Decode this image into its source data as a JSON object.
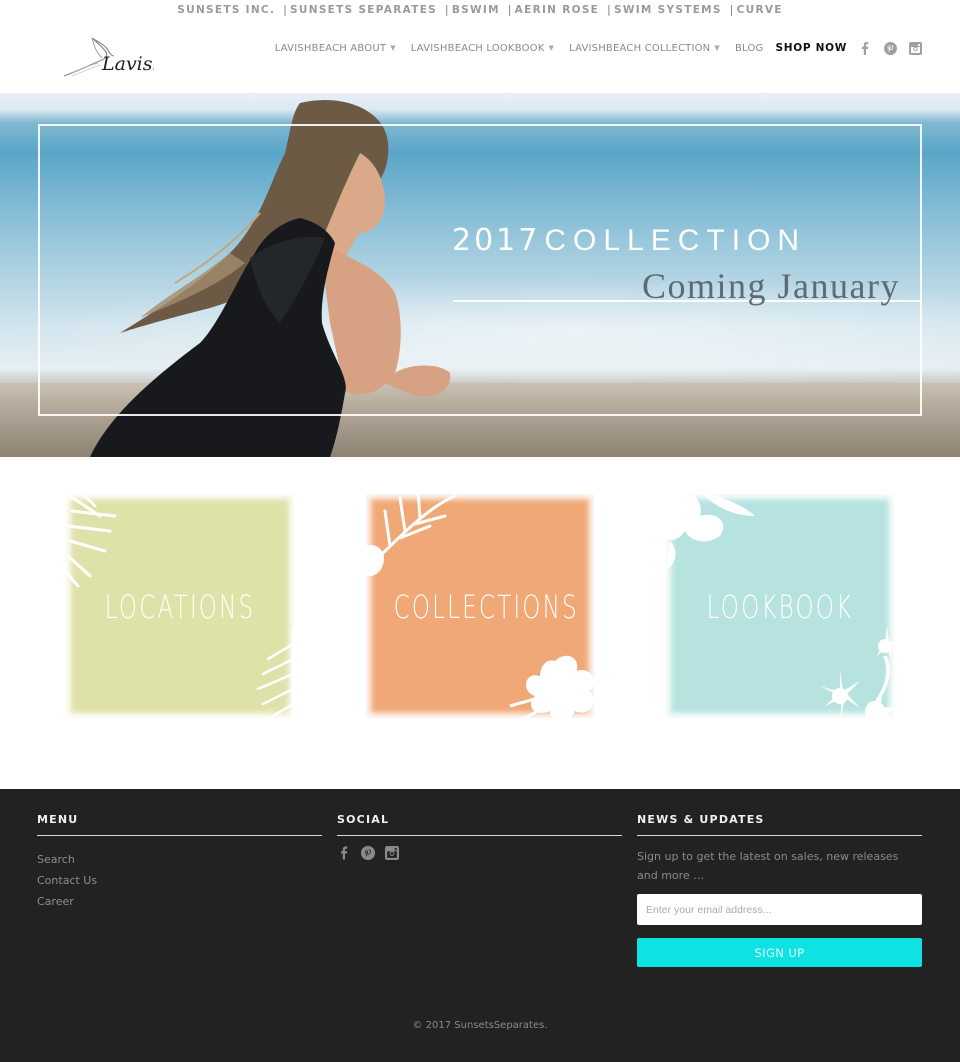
{
  "brand_bar": {
    "items": [
      "SUNSETS INC.",
      "SUNSETS SEPARATES",
      "BSWIM",
      "AERIN ROSE",
      "SWIM SYSTEMS",
      "CURVE"
    ],
    "separator": "|"
  },
  "header": {
    "logo_text": "Lavish",
    "nav": [
      {
        "label": "LAVISHBEACH ABOUT",
        "caret": "▼"
      },
      {
        "label": "LAVISHBEACH LOOKBOOK",
        "caret": "▼"
      },
      {
        "label": "LAVISHBEACH COLLECTION",
        "caret": "▼"
      },
      {
        "label": "BLOG"
      },
      {
        "label": "SHOP NOW"
      }
    ],
    "social_icons": [
      "facebook-icon",
      "pinterest-icon",
      "instagram-icon"
    ]
  },
  "hero": {
    "year": "2017",
    "title": "COLLECTION",
    "subtitle": "Coming January"
  },
  "tiles": [
    {
      "label": "LOCATIONS",
      "color": "#dfe2a8"
    },
    {
      "label": "COLLECTIONS",
      "color": "#f0a877"
    },
    {
      "label": "LOOKBOOK",
      "color": "#b6e3df"
    }
  ],
  "footer": {
    "menu": {
      "heading": "MENU",
      "links": [
        "Search",
        "Contact Us",
        "Career"
      ]
    },
    "social": {
      "heading": "SOCIAL",
      "icons": [
        "facebook-icon",
        "pinterest-icon",
        "instagram-icon"
      ]
    },
    "news": {
      "heading": "NEWS & UPDATES",
      "text": "Sign up to get the latest on sales, new releases and more …",
      "email_placeholder": "Enter your email address...",
      "email_value": "",
      "button_label": "SIGN UP",
      "button_color": "#0fe2e2"
    },
    "copyright": "© 2017 SunsetsSeparates."
  }
}
